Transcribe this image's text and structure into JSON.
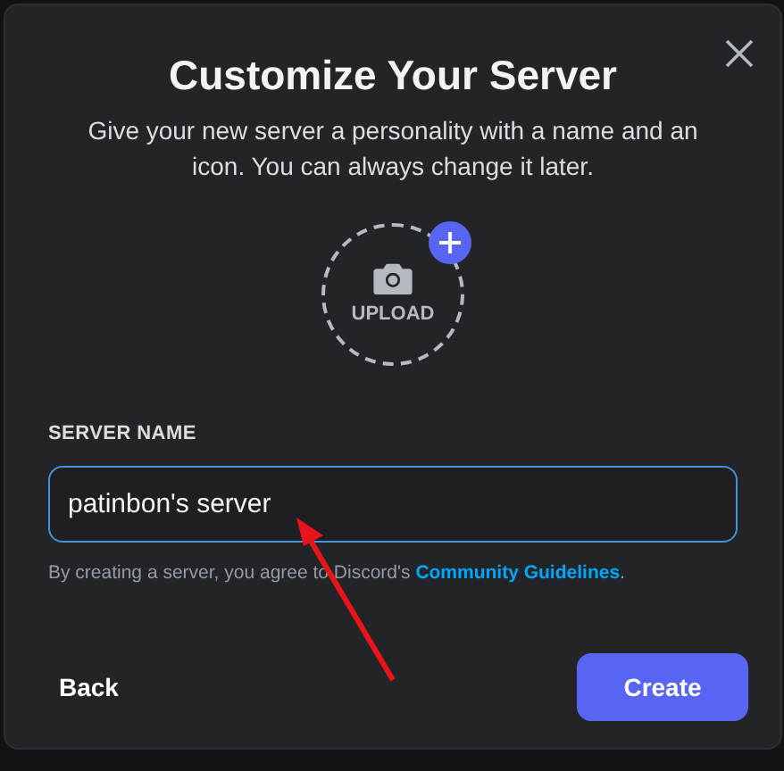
{
  "dialog": {
    "title": "Customize Your Server",
    "subtitle": "Give your new server a personality with a name and an icon. You can always change it later.",
    "upload_label": "UPLOAD"
  },
  "server_name": {
    "label": "SERVER NAME",
    "value": "patinbon's server",
    "focused": true
  },
  "legal": {
    "text_before": "By creating a server, you agree to Discord's ",
    "link": "Community Guidelines",
    "text_after": "."
  },
  "buttons": [
    {
      "label": "Back",
      "kind": "secondary"
    },
    {
      "label": "Create",
      "kind": "primary"
    }
  ]
}
